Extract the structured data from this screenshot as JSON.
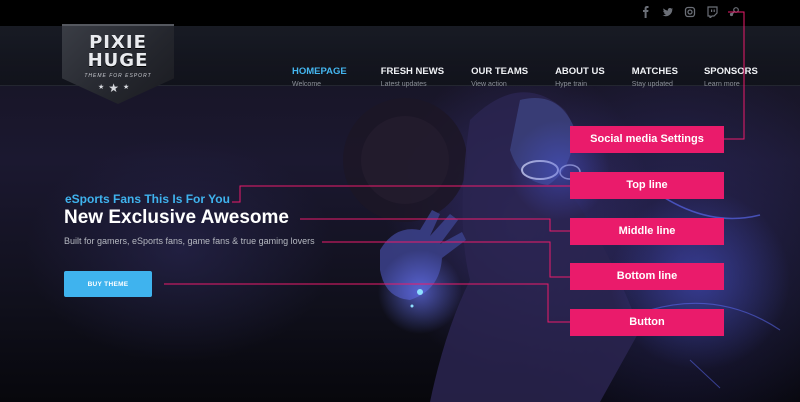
{
  "social": {
    "icons": [
      "facebook-icon",
      "twitter-icon",
      "instagram-icon",
      "twitch-icon",
      "steam-icon"
    ]
  },
  "logo": {
    "line1": "PIXIE",
    "line2": "HUGE",
    "tagline": "THEME FOR ESPORT"
  },
  "menu": [
    {
      "label": "HOMEPAGE",
      "sub": "Welcome",
      "active": true
    },
    {
      "label": "FRESH NEWS",
      "sub": "Latest updates"
    },
    {
      "label": "OUR TEAMS",
      "sub": "View action"
    },
    {
      "label": "ABOUT US",
      "sub": "Hype train"
    },
    {
      "label": "MATCHES",
      "sub": "Stay updated"
    },
    {
      "label": "SPONSORS",
      "sub": "Learn more"
    }
  ],
  "hero": {
    "top_line": "eSports Fans This Is For You",
    "middle_line": "New Exclusive Awesome",
    "bottom_line": "Built for gamers, eSports fans, game fans & true gaming lovers",
    "button_label": "BUY THEME"
  },
  "annotations": {
    "social": "Social media Settings",
    "top_line": "Top line",
    "middle_line": "Middle line",
    "bottom_line": "Bottom line",
    "button": "Button"
  },
  "colors": {
    "accent": "#3fb3ee",
    "annotation": "#ea1b6b",
    "background": "#07080c"
  }
}
